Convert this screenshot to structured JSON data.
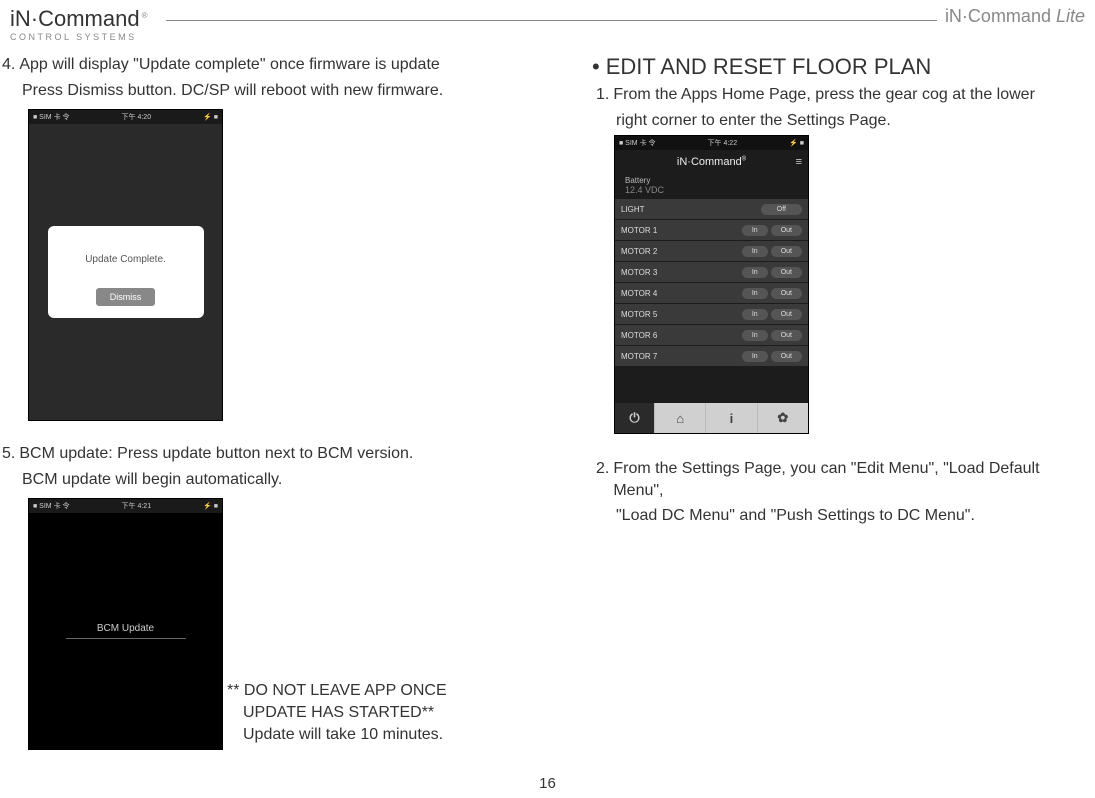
{
  "header": {
    "logo_left_main": "iN·Command",
    "logo_left_sub": "CONTROL SYSTEMS",
    "logo_left_reg": "®",
    "logo_right_main": "iN·Command",
    "logo_right_lite": " Lite"
  },
  "left": {
    "step4_num": "4.",
    "step4_line1": "App will display \"Update complete\" once firmware is update",
    "step4_line2": "Press Dismiss button. DC/SP will reboot with new firmware.",
    "phone1_status_left": "■ SIM 卡 令",
    "phone1_status_center": "下午 4:20",
    "phone1_status_right": "⚡ ■",
    "phone1_modal_msg": "Update Complete.",
    "phone1_modal_btn": "Dismiss",
    "step5_num": "5.",
    "step5_line1": "BCM update: Press update button next to BCM version.",
    "step5_line2": "BCM update will begin automatically.",
    "phone2_status_left": "■ SIM 卡 令",
    "phone2_status_center": "下午 4:21",
    "phone2_status_right": "⚡ ■",
    "phone2_bcm": "BCM Update",
    "warning_l1": "** DO NOT LEAVE APP ONCE",
    "warning_l2": "UPDATE HAS STARTED**",
    "warning_l3": "Update will take 10 minutes."
  },
  "right": {
    "bullet": "•",
    "section_title": "EDIT AND RESET FLOOR PLAN",
    "step1_num": "1.",
    "step1_line1": "From the Apps Home Page, press the gear cog at the lower",
    "step1_line2": "right corner to enter the Settings Page.",
    "app_status_left": "■ SIM 卡 令",
    "app_status_center": "下午 4:22",
    "app_status_right": "⚡ ■",
    "app_title": "iN·Command",
    "app_title_reg": "®",
    "batt_label": "Battery",
    "batt_value": "12.4 VDC",
    "rows": [
      {
        "label": "LIGHT",
        "btns": [
          "Off"
        ]
      },
      {
        "label": "MOTOR 1",
        "btns": [
          "In",
          "Out"
        ]
      },
      {
        "label": "MOTOR 2",
        "btns": [
          "In",
          "Out"
        ]
      },
      {
        "label": "MOTOR 3",
        "btns": [
          "In",
          "Out"
        ]
      },
      {
        "label": "MOTOR 4",
        "btns": [
          "In",
          "Out"
        ]
      },
      {
        "label": "MOTOR 5",
        "btns": [
          "In",
          "Out"
        ]
      },
      {
        "label": "MOTOR 6",
        "btns": [
          "In",
          "Out"
        ]
      },
      {
        "label": "MOTOR 7",
        "btns": [
          "In",
          "Out"
        ]
      }
    ],
    "nav_power": "⏻",
    "nav_home": "⌂",
    "nav_info": "i",
    "nav_gear": "✿",
    "step2_num": "2.",
    "step2_line1": "From the Settings Page, you can \"Edit Menu\", \"Load Default Menu\",",
    "step2_line2": "\"Load DC Menu\" and \"Push Settings to DC Menu\"."
  },
  "page_number": "16"
}
